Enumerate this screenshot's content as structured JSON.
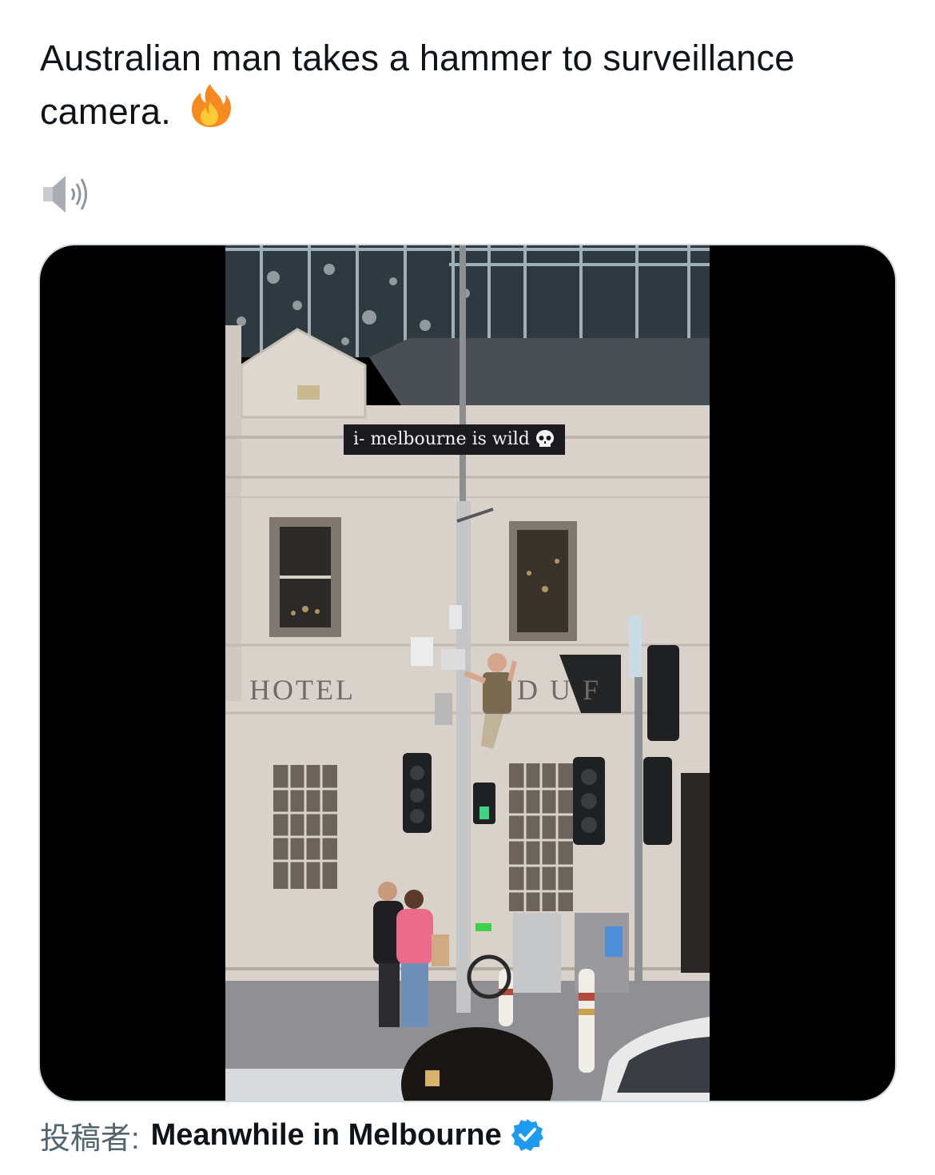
{
  "post": {
    "text": "Australian man takes a hammer to surveillance camera.",
    "emoji": "fire-emoji"
  },
  "audio": {
    "icon": "speaker-icon"
  },
  "media": {
    "caption": "i- melbourne is wild",
    "caption_emoji": "skull-emoji",
    "sign_left": "HOTEL",
    "sign_right": "D U    F"
  },
  "credit": {
    "prefix": "投稿者:",
    "author": "Meanwhile in Melbourne",
    "badge_icon": "verified-badge-icon"
  },
  "colors": {
    "accent": "#1d9bf0",
    "text": "#0f1419",
    "secondary": "#536471",
    "building": "#d8d2ca"
  }
}
